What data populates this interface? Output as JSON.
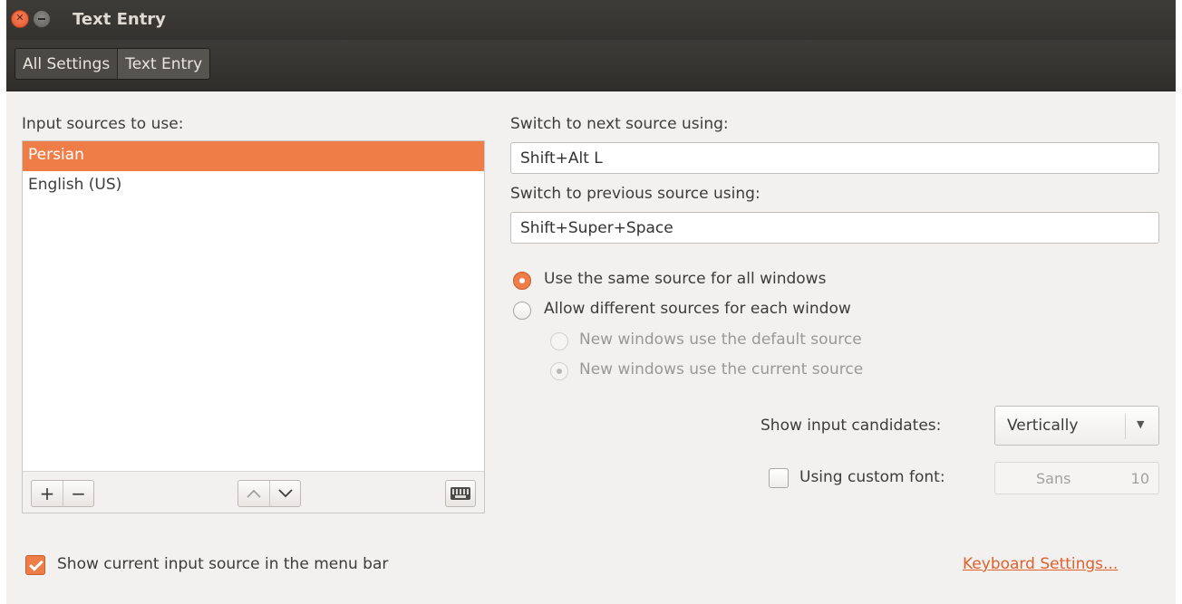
{
  "window": {
    "title": "Text Entry",
    "controls": [
      "close-icon",
      "minimize-icon"
    ]
  },
  "breadcrumbs": [
    "All Settings",
    "Text Entry"
  ],
  "sources": {
    "label": "Input sources to use:",
    "items": [
      "Persian",
      "English (US)"
    ],
    "selected_index": 0,
    "buttons": {
      "add": "+",
      "remove": "−",
      "up": "∧",
      "down": "∨"
    }
  },
  "switching": {
    "next_label": "Switch to next source using:",
    "next_value": "Shift+Alt L",
    "previous_label": "Switch to previous source using:",
    "previous_value": "Shift+Super+Space"
  },
  "source_scope": {
    "same_for_all": "Use the same source for all windows",
    "different_each": "Allow different sources for each window",
    "new_default": "New windows use the default source",
    "new_current": "New windows use the current source",
    "selected": "same_for_all"
  },
  "candidates": {
    "label": "Show input candidates:",
    "value": "Vertically"
  },
  "custom_font": {
    "label": "Using custom font:",
    "checked": false,
    "font_name": "Sans",
    "font_size": "10"
  },
  "footer": {
    "show_in_menu_bar": "Show current input source in the menu bar",
    "show_in_menu_bar_checked": true,
    "keyboard_settings_link": "Keyboard Settings..."
  },
  "colors": {
    "accent": "#ef7d47",
    "titlebar": "#3c3b37",
    "window_bg": "#f2f1f0",
    "link": "#e0602a"
  }
}
